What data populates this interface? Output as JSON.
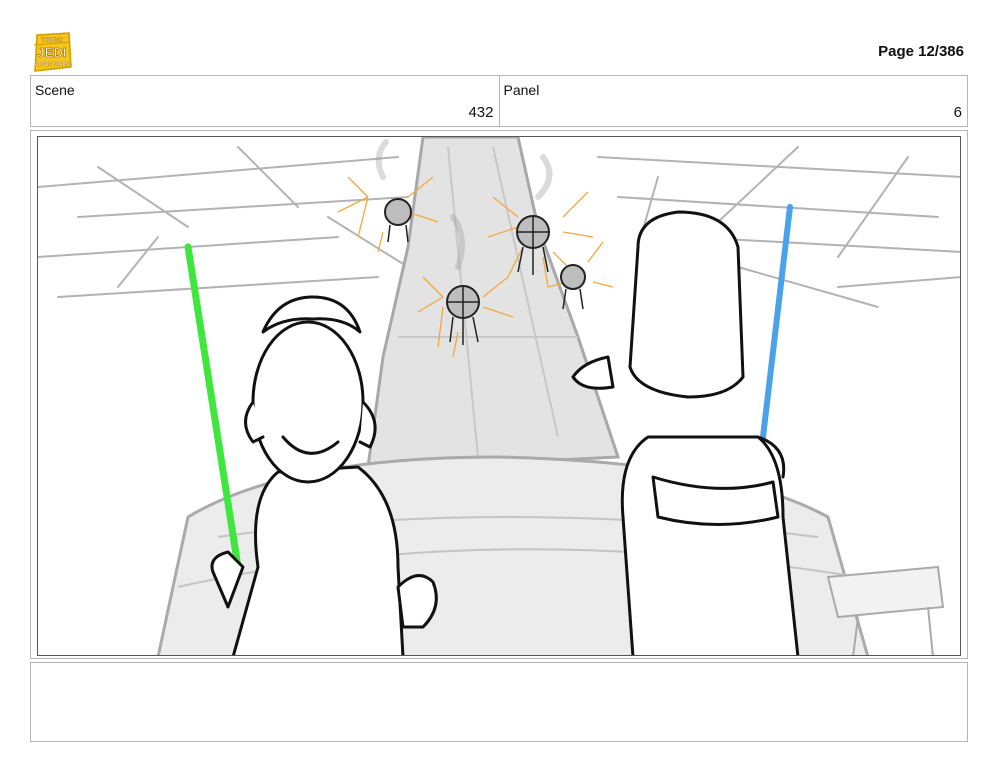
{
  "header": {
    "logo_icon": "jedi-show-logo",
    "logo_lines": [
      "YOUNG",
      "JEDI",
      "ADVENTURES"
    ],
    "page_label": "Page 12/386"
  },
  "info": {
    "scene_label": "Scene",
    "scene_value": "432",
    "panel_label": "Panel",
    "panel_value": "6"
  },
  "colors": {
    "green_saber": "#3ee63e",
    "blue_saber": "#4aa3e8",
    "glow": "#f2a93b",
    "border": "#b5b5b5"
  },
  "notes": {
    "text": ""
  }
}
